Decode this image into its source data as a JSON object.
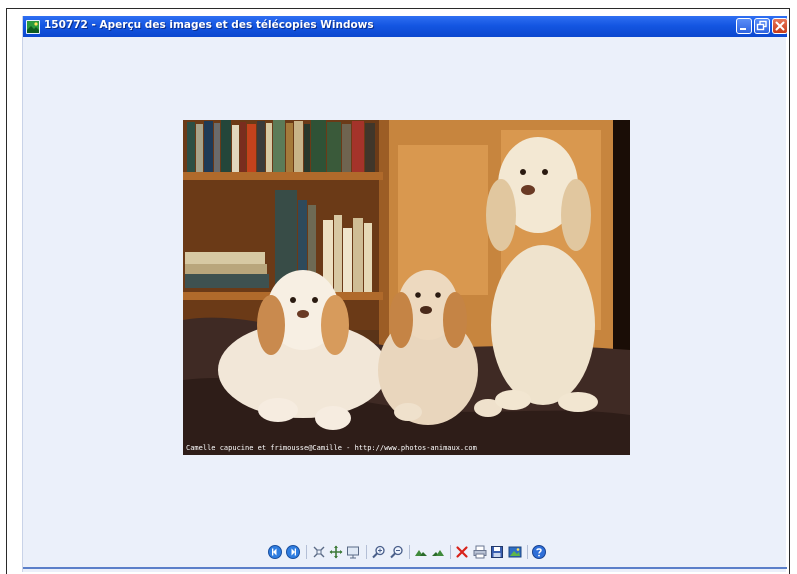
{
  "window": {
    "title": "150772 - Aperçu des images et des télécopies Windows"
  },
  "photo": {
    "caption": "Camelle capucine et frimousse@Camille - http://www.photos-animaux.com"
  },
  "toolbar": {
    "items": [
      "previous-image",
      "next-image",
      "best-fit",
      "actual-size",
      "slideshow",
      "zoom-in",
      "zoom-out",
      "rotate-clockwise",
      "rotate-counterclockwise",
      "delete",
      "print",
      "copy-to",
      "close-and-open",
      "help"
    ]
  },
  "colors": {
    "titlebar": "#1456e2",
    "window_bg": "#ebf0fa",
    "close_button": "#c63a18"
  }
}
